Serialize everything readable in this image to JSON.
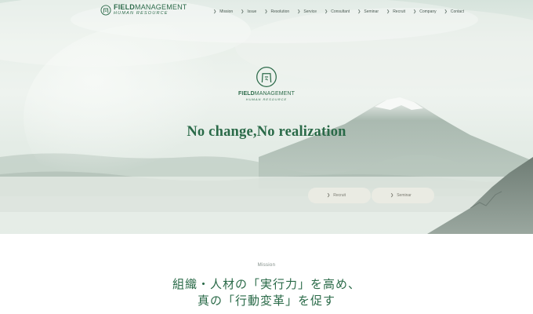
{
  "header": {
    "logo": {
      "brand_bold": "FIELD",
      "brand_rest": "MANAGEMENT",
      "sub": "HUMAN RESOURCE"
    },
    "nav": [
      {
        "label": "Mission"
      },
      {
        "label": "Issue"
      },
      {
        "label": "Resolution"
      },
      {
        "label": "Service"
      },
      {
        "label": "Consultant"
      },
      {
        "label": "Seminar"
      },
      {
        "label": "Recruit"
      },
      {
        "label": "Company"
      },
      {
        "label": "Contact"
      }
    ]
  },
  "hero": {
    "logo": {
      "brand_bold": "FIELD",
      "brand_rest": "MANAGEMENT",
      "sub": "HUMAN RESOURCE"
    },
    "tagline": "No change,No realization",
    "buttons": {
      "recruit": "Recruit",
      "seminar": "Seminar"
    }
  },
  "mission": {
    "label": "Mission",
    "line1": "組織・人材の「実行力」を高め、",
    "line2": "真の「行動変革」を促す"
  },
  "colors": {
    "brand_green": "#2a6a48",
    "hero_mist": "#e8efe9"
  },
  "icons": {
    "nav_chevron": "chevron-right-icon",
    "logo": "field-management-emblem-icon"
  }
}
